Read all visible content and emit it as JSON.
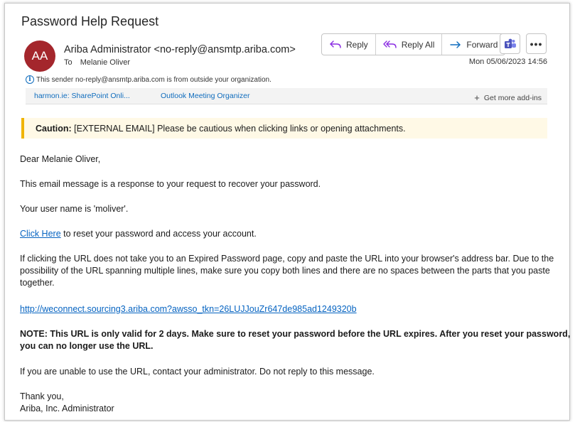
{
  "email": {
    "subject": "Password Help Request",
    "avatar_initials": "AA",
    "sender": "Ariba Administrator <no-reply@ansmtp.ariba.com>",
    "to_label": "To",
    "recipient": "Melanie Oliver",
    "external_notice": "This sender no-reply@ansmtp.ariba.com is from outside your organization.",
    "date": "Mon 05/06/2023 14:56"
  },
  "toolbar": {
    "reply_label": "Reply",
    "reply_all_label": "Reply All",
    "forward_label": "Forward",
    "more_label": "•••"
  },
  "addins": {
    "item1": "harmon.ie: SharePoint Onli...",
    "item2": "Outlook Meeting Organizer",
    "get_more": "Get more add-ins"
  },
  "caution": {
    "label": "Caution:",
    "text": " [EXTERNAL EMAIL] Please be cautious when clicking links or opening attachments."
  },
  "body": {
    "greeting": "Dear Melanie Oliver,",
    "p1": "This email message is a response to your request to recover your password.",
    "p2": "Your user name is 'moliver'.",
    "click_here": "Click Here",
    "p3_rest": " to reset your password and access your account.",
    "p4_line1": "If clicking the URL does not take you to an Expired Password page, copy and paste the URL into your browser's address bar.  Due to the",
    "p4_line2": "possibility of the URL spanning multiple lines, make sure you copy both lines and there are no spaces between the parts that you paste",
    "p4_line3": "together.",
    "url": "http://weconnect.sourcing3.ariba.com?awsso_tkn=26LUJJouZr647de985ad1249320b",
    "note_line1": "NOTE: This URL is only valid for 2 days.  Make sure to reset your password before the URL expires. After you reset your password,",
    "note_line2": "you can no longer use the URL.",
    "p5": "If you are unable to use the URL, contact your administrator. Do not reply to this message.",
    "signoff": "Thank you,",
    "signature": "Ariba, Inc. Administrator"
  },
  "colors": {
    "avatar": "#a4262c",
    "link": "#0563c1",
    "caution_bar": "#f0b400",
    "caution_bg": "#fff9e6",
    "addin_link": "#0f6cbd"
  }
}
